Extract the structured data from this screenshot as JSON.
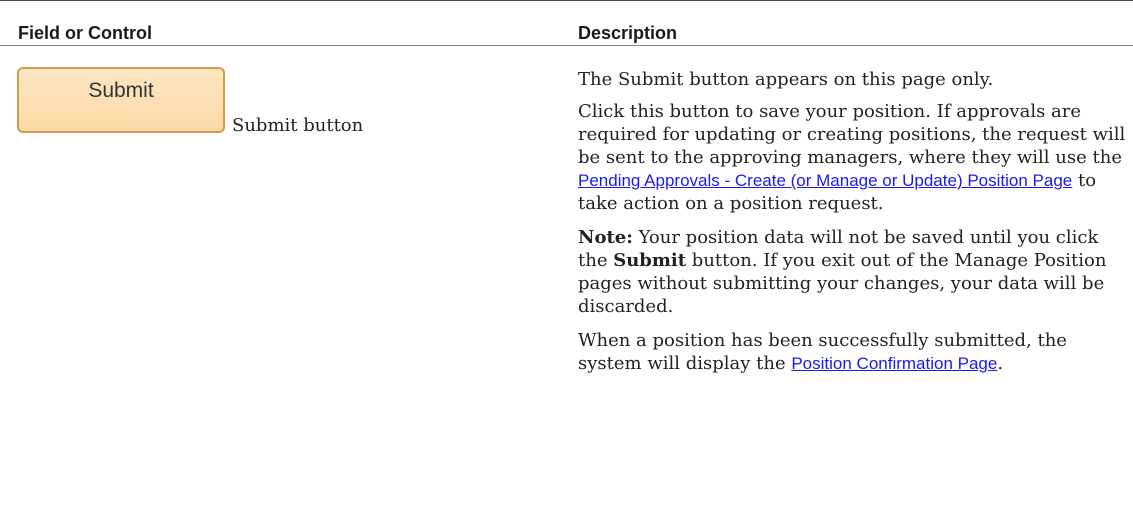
{
  "table": {
    "headers": {
      "field": "Field or Control",
      "description": "Description"
    },
    "row": {
      "button_label": "Submit",
      "field_label": "Submit button",
      "p1": "The Submit button appears on this page only.",
      "p2_text_a": "Click this button to save your position. If approvals are required for updating or creating positions, the request will be sent to the approving managers, where they will use the ",
      "p2_link": "Pending Approvals - Create (or Manage or Update) Position Page",
      "p2_text_b": " to take action on a position request.",
      "p3_label": "Note:",
      "p3_text_a": " Your position data will not be saved until you click the ",
      "p3_bold": "Submit",
      "p3_text_b": " button. If you exit out of the Manage Position pages without submitting your changes, your data will be discarded.",
      "p4_text_a": "When a position has been successfully submitted, the system will display the ",
      "p4_link": "Position Confirmation Page",
      "p4_text_b": "."
    }
  },
  "colors": {
    "link": "#1a1aee",
    "button_fill": "#fbd9a6",
    "button_border": "#d49a4b"
  }
}
